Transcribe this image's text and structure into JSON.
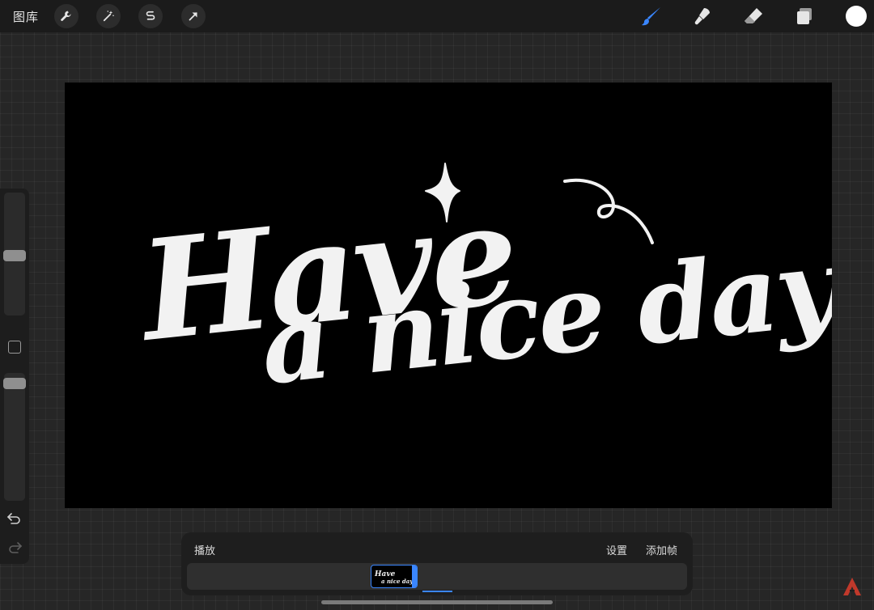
{
  "topbar": {
    "gallery_label": "图库",
    "left_tools": [
      "wrench-icon",
      "magic-wand-icon",
      "selection-icon",
      "transform-arrow-icon"
    ],
    "right_tools": [
      "brush-icon",
      "smudge-icon",
      "eraser-icon",
      "layers-icon"
    ],
    "active_tool": "brush-icon",
    "current_color": "#ffffff",
    "accent_color": "#3a86ff"
  },
  "canvas": {
    "artwork_text_line1": "Have",
    "artwork_text_line2": "a nice day",
    "background": "#000000",
    "ink_color": "#f2f2f2"
  },
  "sidebar": {
    "brush_size_level": 0.55,
    "opacity_level": 0.95,
    "icons": [
      "modifier-square-icon",
      "undo-icon",
      "redo-icon"
    ]
  },
  "timeline": {
    "play_label": "播放",
    "settings_label": "设置",
    "add_frame_label": "添加帧",
    "frame_count": 1
  }
}
